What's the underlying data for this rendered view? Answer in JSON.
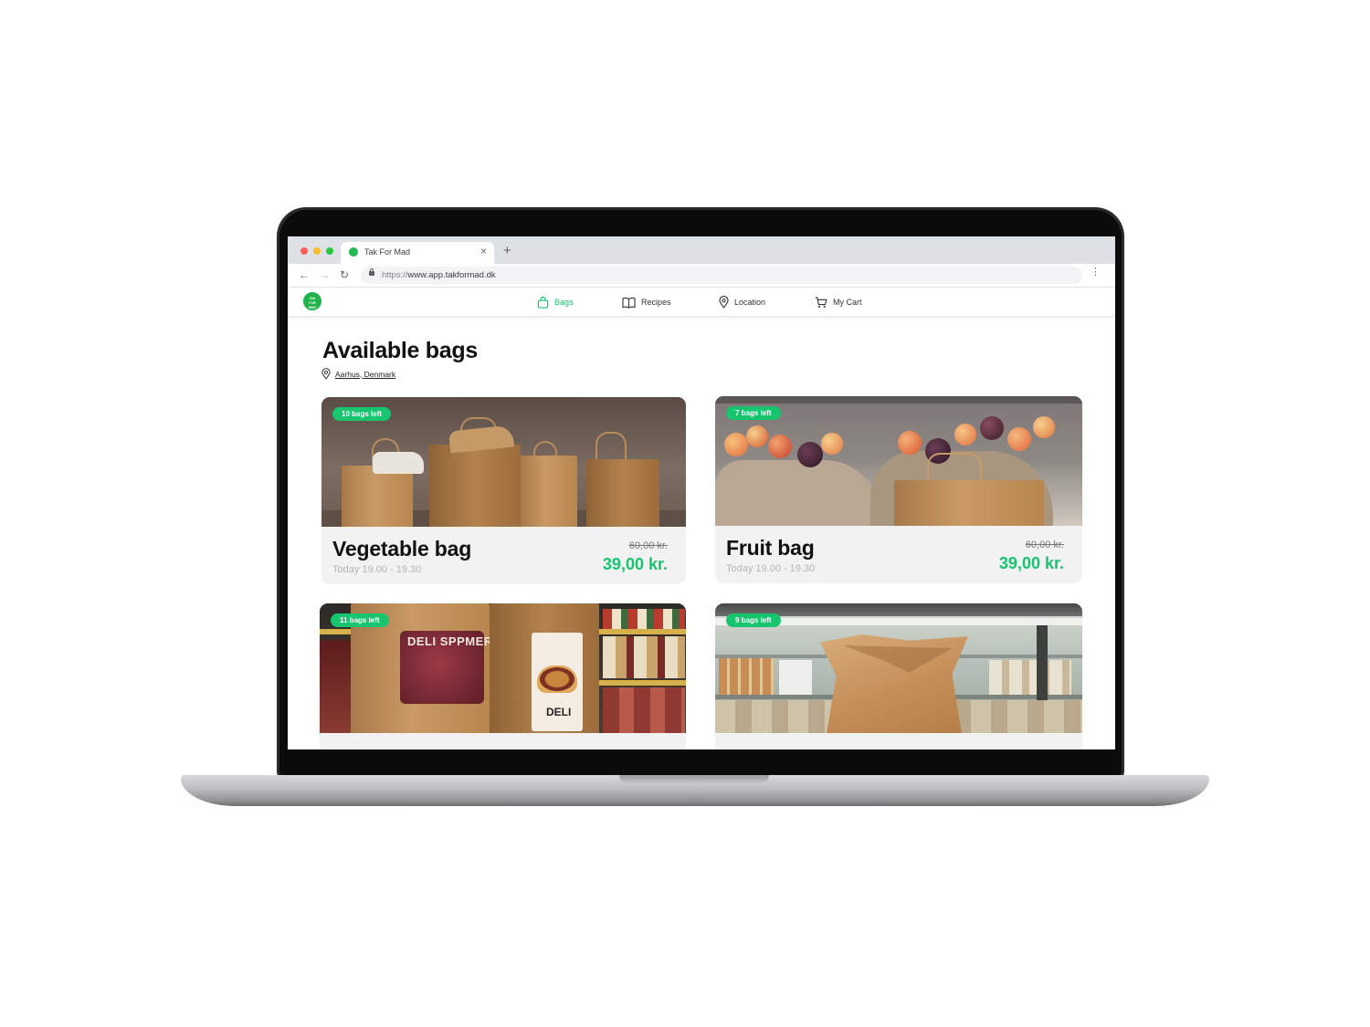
{
  "browser": {
    "tab_title": "Tak For Mad",
    "url_protocol": "https://",
    "url_host": "www.app.takformad.dk"
  },
  "nav": {
    "logo_text": "TAK FOR MAD",
    "items": [
      {
        "label": "Bags",
        "icon": "bag-icon",
        "active": true
      },
      {
        "label": "Recipes",
        "icon": "book-icon",
        "active": false
      },
      {
        "label": "Location",
        "icon": "map-pin-icon",
        "active": false
      },
      {
        "label": "My Cart",
        "icon": "cart-icon",
        "active": false
      }
    ]
  },
  "page": {
    "title": "Available bags",
    "location": "Aarhus, Denmark"
  },
  "bags": [
    {
      "badge": "10 bags left",
      "name": "Vegetable bag",
      "time": "Today 19.00 - 19.30",
      "old_price": "60,00 kr.",
      "price": "39,00 kr."
    },
    {
      "badge": "7 bags left",
      "name": "Fruit bag",
      "time": "Today 19.00 - 19.30",
      "old_price": "60,00 kr.",
      "price": "39,00 kr."
    },
    {
      "badge": "11 bags left",
      "name": "",
      "time": "",
      "old_price": "",
      "price": "",
      "image_text_1": "DELI SPPMER",
      "image_text_2": "DELI"
    },
    {
      "badge": "9 bags left",
      "name": "",
      "time": "",
      "old_price": "",
      "price": ""
    }
  ],
  "colors": {
    "accent": "#16c56e",
    "logo": "#1fb34a"
  }
}
